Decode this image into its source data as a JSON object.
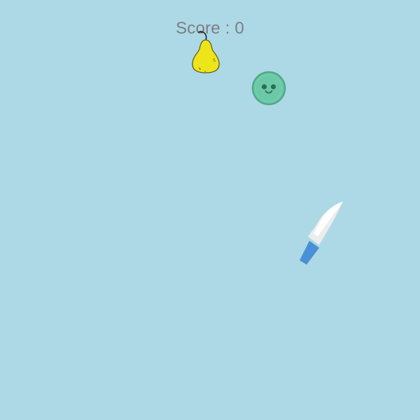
{
  "hud": {
    "score_label": "Score",
    "separator": " : ",
    "score_value": "0"
  },
  "game": {
    "background_color": "#add8e6",
    "objects": [
      {
        "kind": "fruit",
        "name": "pear",
        "color": "#f0e21c"
      },
      {
        "kind": "bomb-like",
        "name": "green-slime",
        "color": "#6cc9a8"
      },
      {
        "kind": "player-tool",
        "name": "knife",
        "blade_color": "#f5f5f5",
        "handle_color": "#4a90d6"
      }
    ]
  }
}
